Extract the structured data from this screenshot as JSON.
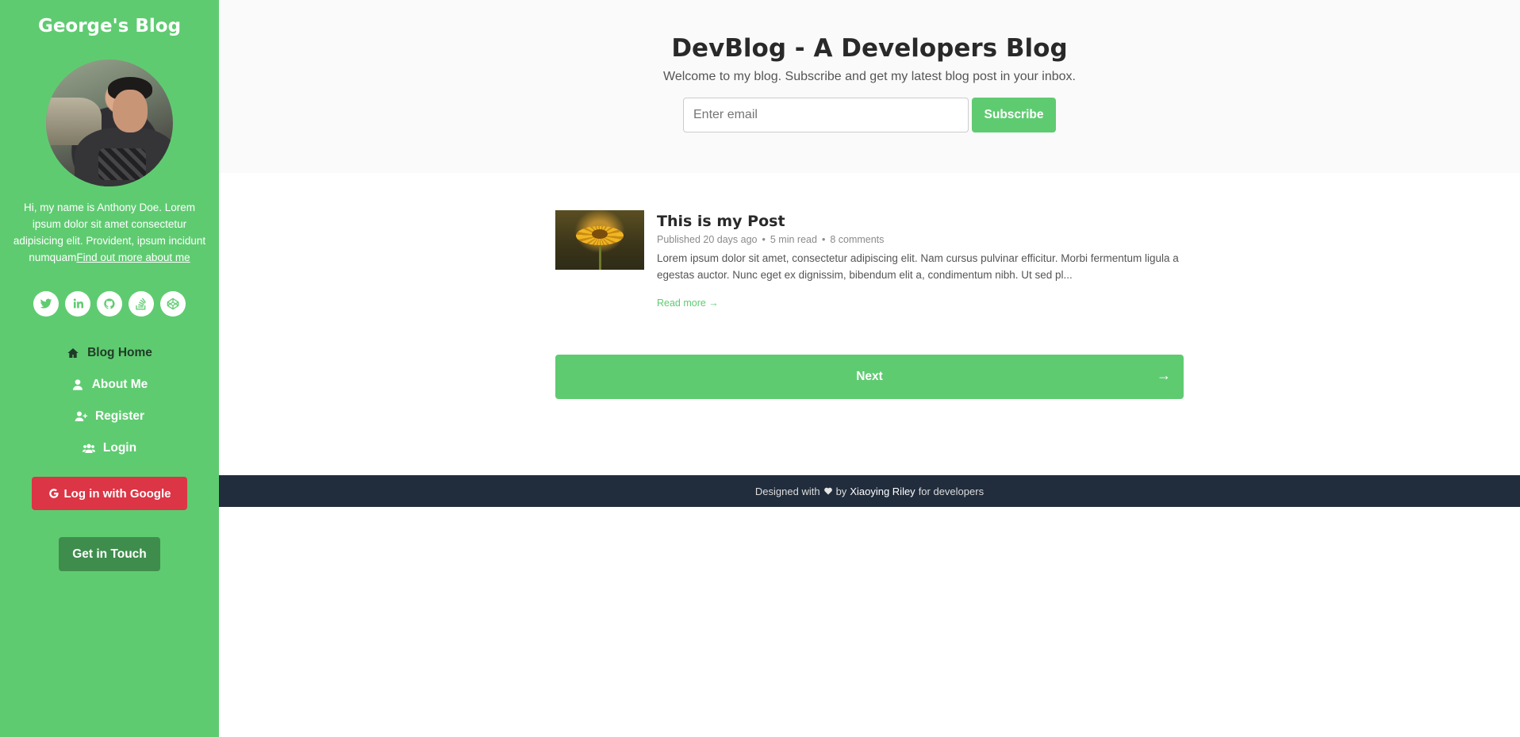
{
  "sidebar": {
    "blog_name": "George's Blog",
    "bio_text": "Hi, my name is Anthony Doe. Lorem ipsum dolor sit amet consectetur adipisicing elit. Provident, ipsum incidunt numquam",
    "bio_link": "Find out more about me",
    "socials": [
      "twitter-icon",
      "linkedin-icon",
      "github-icon",
      "stack-overflow-icon",
      "codepen-icon"
    ],
    "nav": [
      {
        "label": "Blog Home",
        "icon": "home-icon"
      },
      {
        "label": "About Me",
        "icon": "user-icon"
      },
      {
        "label": "Register",
        "icon": "user-plus-icon"
      },
      {
        "label": "Login",
        "icon": "users-icon"
      }
    ],
    "google_button": "Log in with Google",
    "contact_button": "Get in Touch"
  },
  "header": {
    "title": "DevBlog - A Developers Blog",
    "intro": "Welcome to my blog. Subscribe and get my latest blog post in your inbox.",
    "email_placeholder": "Enter email",
    "subscribe_label": "Subscribe"
  },
  "post": {
    "title": "This is my Post",
    "published": "Published 20 days ago",
    "read_time": "5 min read",
    "comments": "8 comments",
    "excerpt": "Lorem ipsum dolor sit amet, consectetur adipiscing elit. Nam cursus pulvinar efficitur. Morbi fermentum ligula a egestas auctor. Nunc eget ex dignissim, bibendum elit a, condimentum nibh. Ut sed pl...",
    "read_more": "Read more →"
  },
  "pagination": {
    "next_label": "Next",
    "next_arrow": "→"
  },
  "footer": {
    "designed_with": "Designed with",
    "by": "by",
    "author": "Xiaoying Riley",
    "suffix": "for developers"
  },
  "colors": {
    "accent": "#5fcb71",
    "google": "#dc3545",
    "footer_bg": "#212d3d"
  }
}
